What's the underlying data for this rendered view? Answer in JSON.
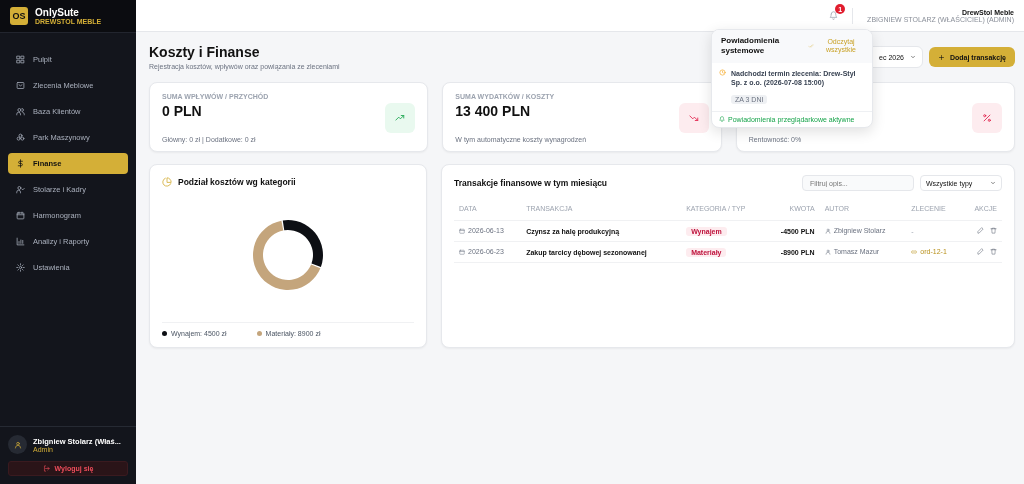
{
  "brand": {
    "logo": "OS",
    "name": "OnlySute",
    "subtitle": "DREWSTOL MEBLE"
  },
  "sidebar": {
    "items": [
      {
        "label": "Pulpit",
        "selected": false
      },
      {
        "label": "Zlecenia Meblowe",
        "selected": false
      },
      {
        "label": "Baza Klientów",
        "selected": false
      },
      {
        "label": "Park Maszynowy",
        "selected": false
      },
      {
        "label": "Finanse",
        "selected": true
      },
      {
        "label": "Stolarze i Kadry",
        "selected": false
      },
      {
        "label": "Harmonogram",
        "selected": false
      },
      {
        "label": "Analizy i Raporty",
        "selected": false
      },
      {
        "label": "Ustawienia",
        "selected": false
      }
    ],
    "user": {
      "name": "Zbigniew Stolarz (Właś...",
      "role": "Admin"
    },
    "logout": "Wyloguj się"
  },
  "header": {
    "notification_count": "1",
    "company": "DrewStol Meble",
    "user": "ZBIGNIEW STOLARZ (WŁAŚCICIEL) (ADMIN)"
  },
  "page": {
    "title": "Koszty i Finanse",
    "subtitle": "Rejestracja kosztów, wpływów oraz powiązania ze zleceniami",
    "month_select": "ec 2026",
    "add_button": "Dodaj transakcję"
  },
  "stats": [
    {
      "label": "SUMA WPŁYWÓW / PRZYCHÓD",
      "value": "0 PLN",
      "note": "Główny: 0 zł | Dodatkowe: 0 zł"
    },
    {
      "label": "SUMA WYDATKÓW / KOSZTY",
      "value": "13 400 PLN",
      "note": "W tym automatyczne koszty wynagrodzeń"
    },
    {
      "note": "Rentowność: 0%"
    }
  ],
  "notifications": {
    "title": "Powiadomienia systemowe",
    "mark_all": "Odczytaj wszystkie",
    "items": [
      {
        "text": "Nadchodzi termin zlecenia: Drew-Styl Sp. z o.o. (2026-07-08 15:00)",
        "badge": "ZA 3 DNI"
      }
    ],
    "footer": "Powiadomienia przeglądarkowe aktywne"
  },
  "cost_chart": {
    "title": "Podział kosztów wg kategorii",
    "chart_data": {
      "type": "donut",
      "categories": [
        "Wynajem: 4500 zł",
        "Materiały: 8900 zł"
      ],
      "values": [
        4500,
        8900
      ]
    },
    "legend": [
      {
        "color": "#0d0f14"
      },
      {
        "color": "#c4a57c"
      }
    ]
  },
  "transactions": {
    "title": "Transakcje finansowe w tym miesiącu",
    "filter_placeholder": "Filtruj opis...",
    "type_select": "Wszystkie typy",
    "columns": [
      "DATA",
      "TRANSAKCJA",
      "KATEGORIA / TYP",
      "KWOTA",
      "AUTOR",
      "ZLECENIE",
      "AKCJE"
    ],
    "rows": [
      {
        "date": "2026-06-13",
        "description": "Czynsz za halę produkcyjną",
        "category": "Wynajem",
        "amount": "-4500 PLN",
        "author": "Zbigniew Stolarz",
        "order": "-",
        "order_linked": false
      },
      {
        "date": "2026-06-23",
        "description": "Zakup tarcicy dębowej sezonowanej",
        "category": "Materiały",
        "amount": "-8900 PLN",
        "author": "Tomasz Mazur",
        "order": "ord-12-1",
        "order_linked": true
      }
    ]
  }
}
